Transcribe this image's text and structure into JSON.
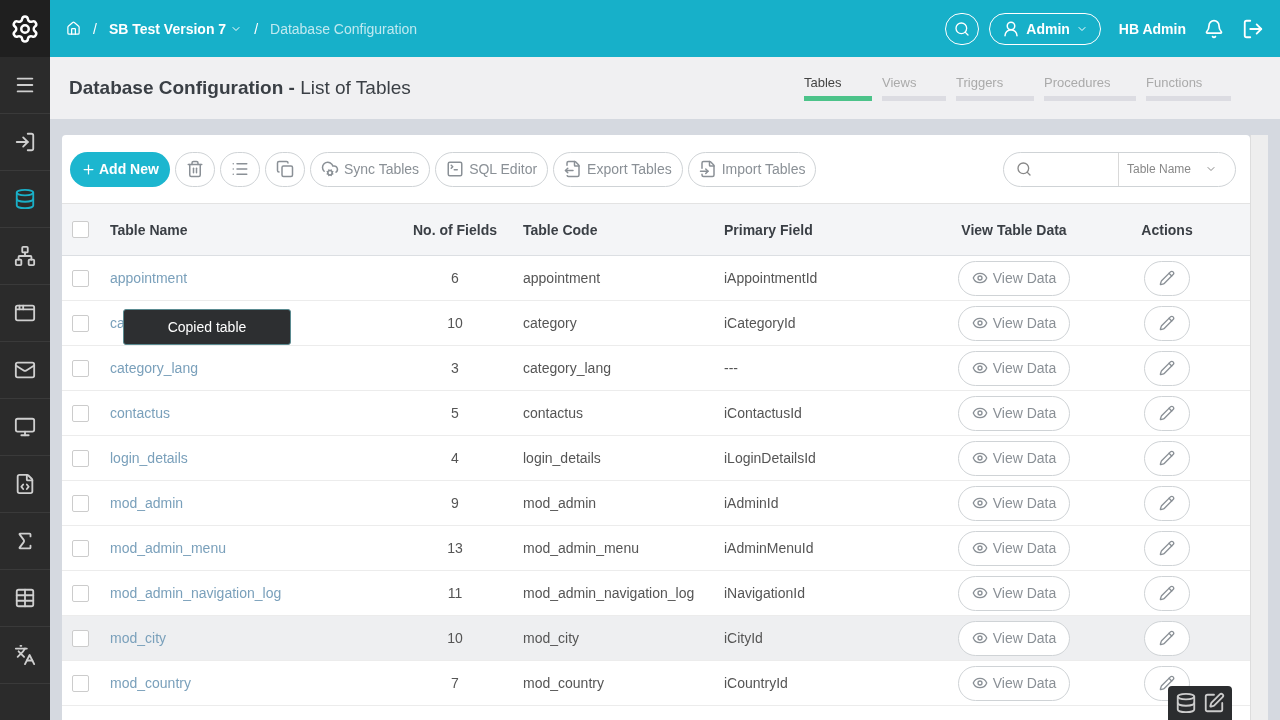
{
  "topbar": {
    "breadcrumb": [
      {
        "separator": "/",
        "label": "SB Test Version 7",
        "dropdown": true,
        "current": false
      },
      {
        "separator": "/",
        "label": "Database Configuration",
        "dropdown": false,
        "current": true
      }
    ],
    "user_menu": "Admin",
    "user_name": "HB Admin"
  },
  "sidebar": {
    "items": [
      {
        "selected": false
      },
      {
        "selected": false
      },
      {
        "selected": true
      },
      {
        "selected": false
      },
      {
        "selected": false
      },
      {
        "selected": false
      },
      {
        "selected": false
      },
      {
        "selected": false
      },
      {
        "selected": false
      },
      {
        "selected": false
      },
      {
        "selected": false
      }
    ]
  },
  "page": {
    "title": "Database Configuration",
    "separator": "-",
    "subtitle": "List of Tables"
  },
  "tabs": [
    {
      "label": "Tables",
      "selected": true
    },
    {
      "label": "Views",
      "selected": false
    },
    {
      "label": "Triggers",
      "selected": false
    },
    {
      "label": "Procedures",
      "selected": false
    },
    {
      "label": "Functions",
      "selected": false
    }
  ],
  "toolbar": [
    {
      "kind": "primary",
      "label": "Add New"
    },
    {
      "kind": "icon"
    },
    {
      "kind": "icon"
    },
    {
      "kind": "icon"
    },
    {
      "kind": "labeled",
      "label": "Sync Tables"
    },
    {
      "kind": "labeled",
      "label": "SQL Editor"
    },
    {
      "kind": "labeled",
      "label": "Export Tables"
    },
    {
      "kind": "labeled",
      "label": "Import Tables"
    }
  ],
  "search": {
    "filter": "Table Name"
  },
  "table": {
    "select_all_checked": false,
    "columns": [
      "Table Name",
      "No. of Fields",
      "Table Code",
      "Primary Field",
      "View Table Data",
      "Actions"
    ],
    "rows": [
      {
        "checked": false,
        "hovered": false,
        "name": "appointment",
        "fields": "6",
        "code": "appointment",
        "primary": "iAppointmentId",
        "action": "View Data"
      },
      {
        "checked": false,
        "hovered": false,
        "name": "ca",
        "fields": "10",
        "code": "category",
        "primary": "iCategoryId",
        "action": "View Data"
      },
      {
        "checked": false,
        "hovered": false,
        "name": "category_lang",
        "fields": "3",
        "code": "category_lang",
        "primary": "---",
        "action": "View Data"
      },
      {
        "checked": false,
        "hovered": false,
        "name": "contactus",
        "fields": "5",
        "code": "contactus",
        "primary": "iContactusId",
        "action": "View Data"
      },
      {
        "checked": false,
        "hovered": false,
        "name": "login_details",
        "fields": "4",
        "code": "login_details",
        "primary": "iLoginDetailsId",
        "action": "View Data"
      },
      {
        "checked": false,
        "hovered": false,
        "name": "mod_admin",
        "fields": "9",
        "code": "mod_admin",
        "primary": "iAdminId",
        "action": "View Data"
      },
      {
        "checked": false,
        "hovered": false,
        "name": "mod_admin_menu",
        "fields": "13",
        "code": "mod_admin_menu",
        "primary": "iAdminMenuId",
        "action": "View Data"
      },
      {
        "checked": false,
        "hovered": false,
        "name": "mod_admin_navigation_log",
        "fields": "11",
        "code": "mod_admin_navigation_log",
        "primary": "iNavigationId",
        "action": "View Data"
      },
      {
        "checked": false,
        "hovered": true,
        "name": "mod_city",
        "fields": "10",
        "code": "mod_city",
        "primary": "iCityId",
        "action": "View Data"
      },
      {
        "checked": false,
        "hovered": false,
        "name": "mod_country",
        "fields": "7",
        "code": "mod_country",
        "primary": "iCountryId",
        "action": "View Data"
      }
    ]
  },
  "tooltip": "Copied table"
}
